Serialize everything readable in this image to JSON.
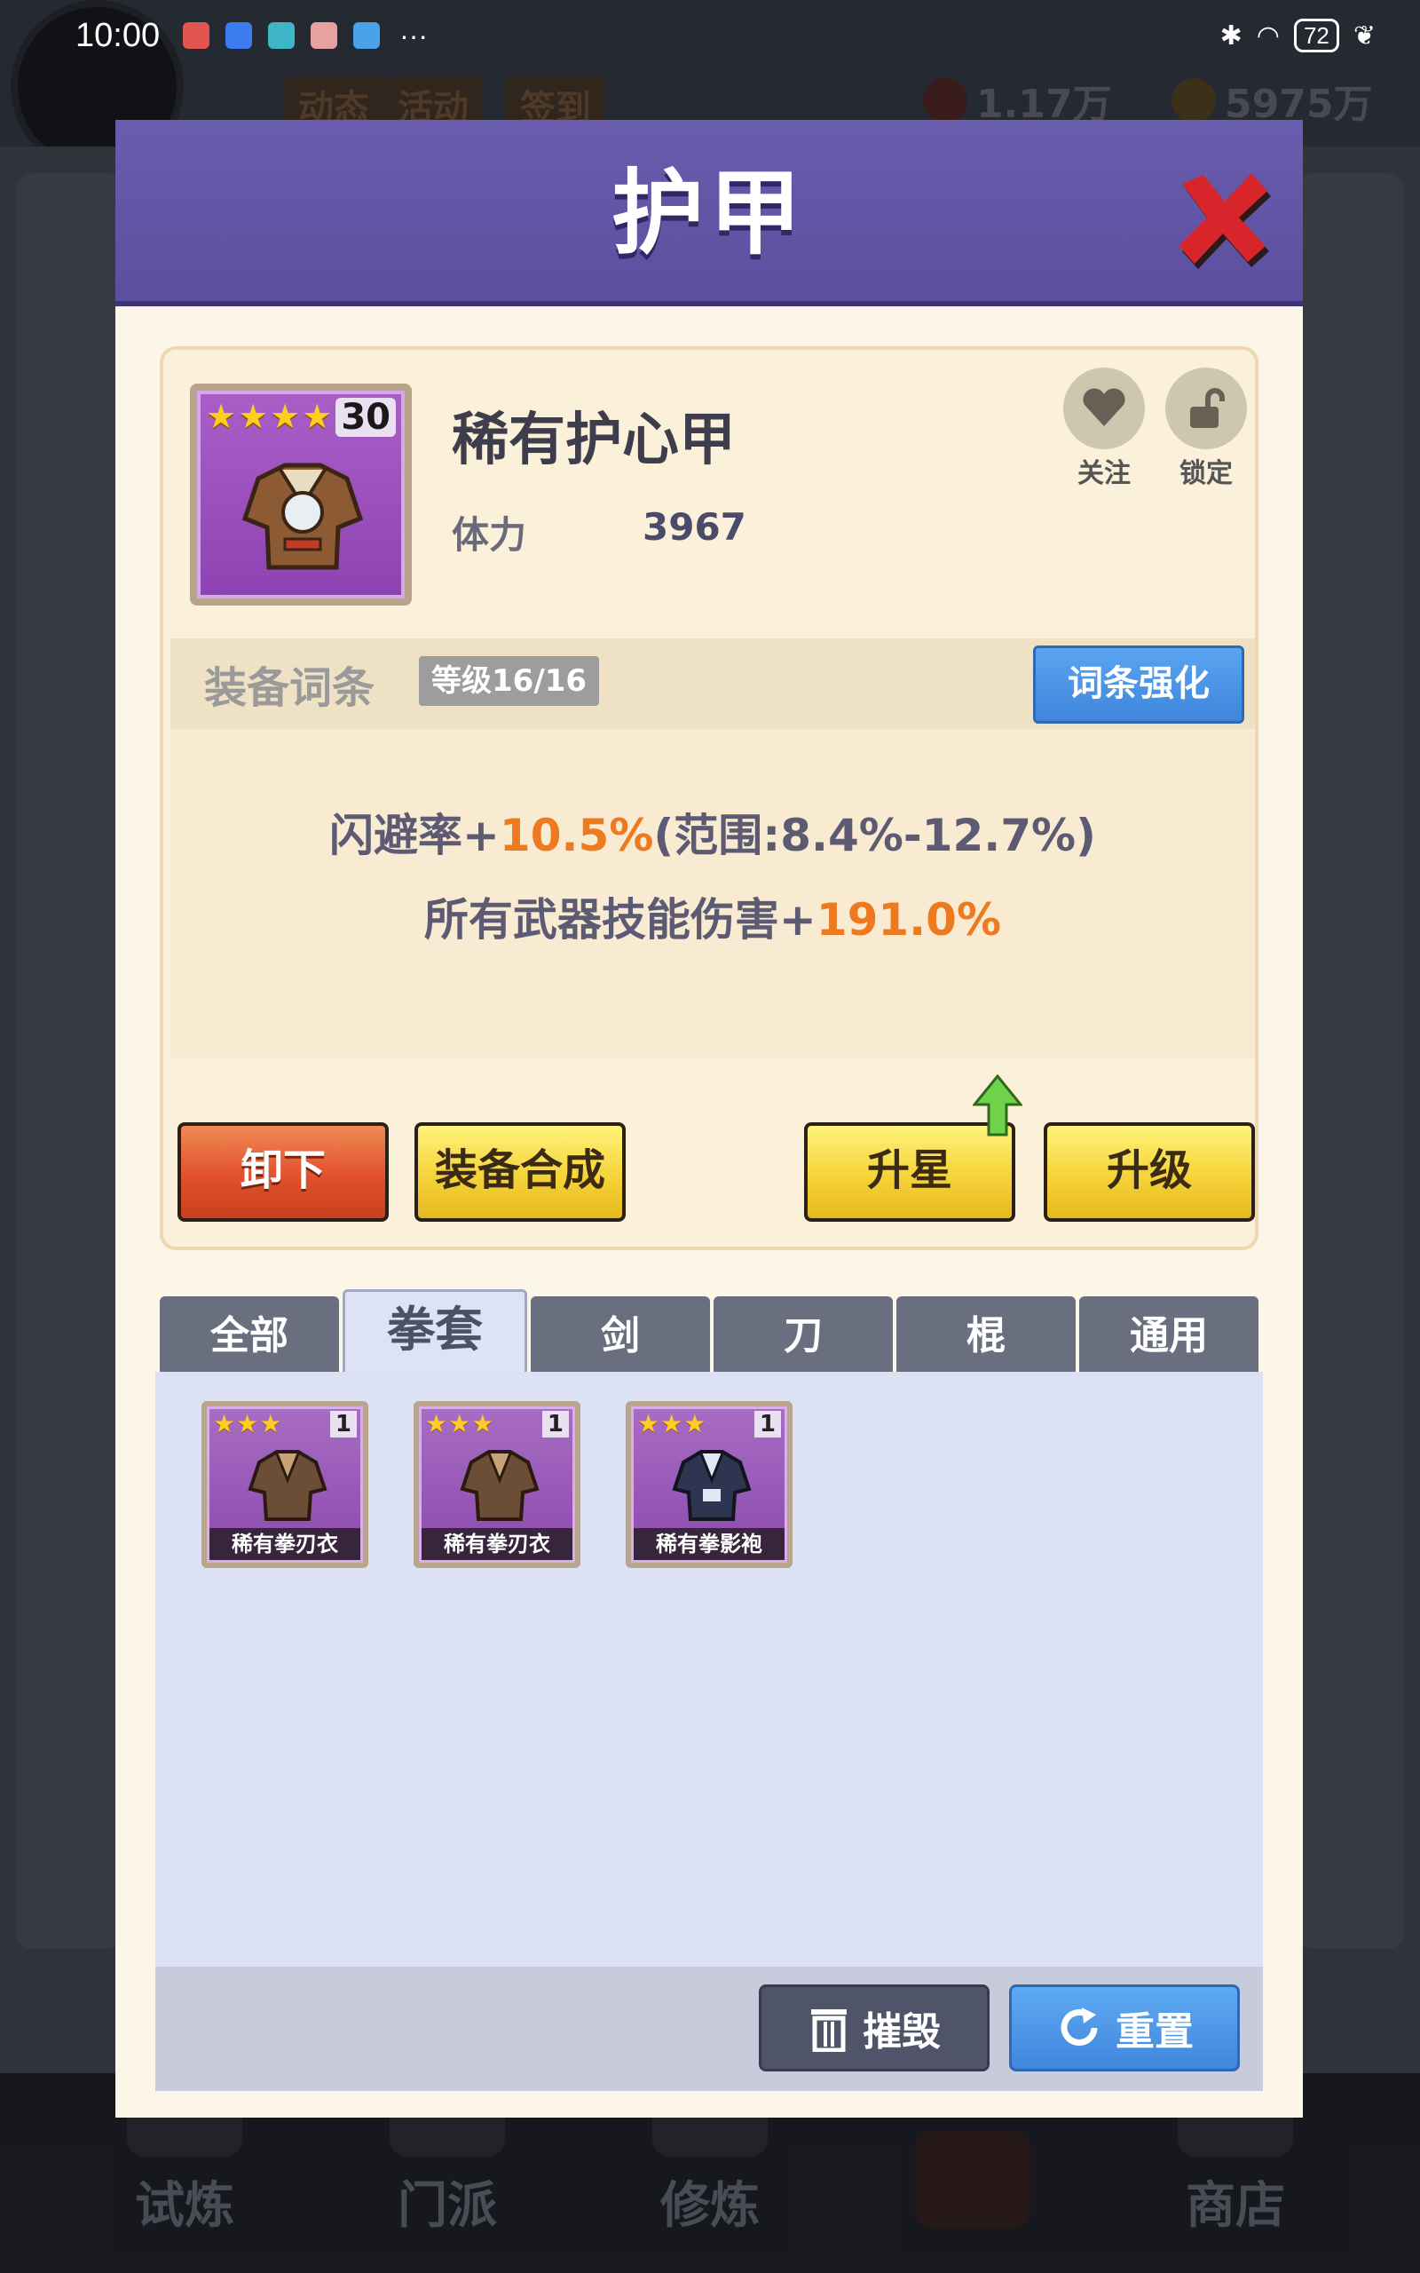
{
  "status_bar": {
    "time": "10:00",
    "more": "···",
    "battery": "72"
  },
  "background": {
    "chips": [
      "动态",
      "活动",
      "签到"
    ],
    "currency_red": "1.17万",
    "currency_gold": "5975万",
    "nav": [
      "试炼",
      "门派",
      "修炼",
      "",
      "商店"
    ]
  },
  "modal": {
    "title": "护甲",
    "item": {
      "name": "稀有护心甲",
      "stars": 4,
      "level": "30",
      "stat_label": "体力",
      "stat_value": "3967"
    },
    "follow_label": "关注",
    "lock_label": "锁定",
    "affix": {
      "title": "装备词条",
      "level": "等级16/16",
      "enhance": "词条强化",
      "line1": {
        "prefix": "闪避率+",
        "value": "10.5%",
        "suffix": "(范围:8.4%-12.7%)"
      },
      "line2": {
        "prefix": "所有武器技能伤害+",
        "value": "191.0%"
      }
    },
    "buttons": {
      "unequip": "卸下",
      "synthesize": "装备合成",
      "star_up": "升星",
      "upgrade": "升级"
    },
    "tabs": [
      "全部",
      "拳套",
      "剑",
      "刀",
      "棍",
      "通用"
    ],
    "active_tab": 1,
    "inventory": [
      {
        "name": "稀有拳刃衣",
        "stars": 3,
        "count": "1"
      },
      {
        "name": "稀有拳刃衣",
        "stars": 3,
        "count": "1"
      },
      {
        "name": "稀有拳影袍",
        "stars": 3,
        "count": "1"
      }
    ],
    "destroy": "摧毁",
    "reset": "重置"
  },
  "colors": {
    "header": "#5c4f9f",
    "highlight": "#ee7a20",
    "enhance_blue": "#3f86dc"
  }
}
